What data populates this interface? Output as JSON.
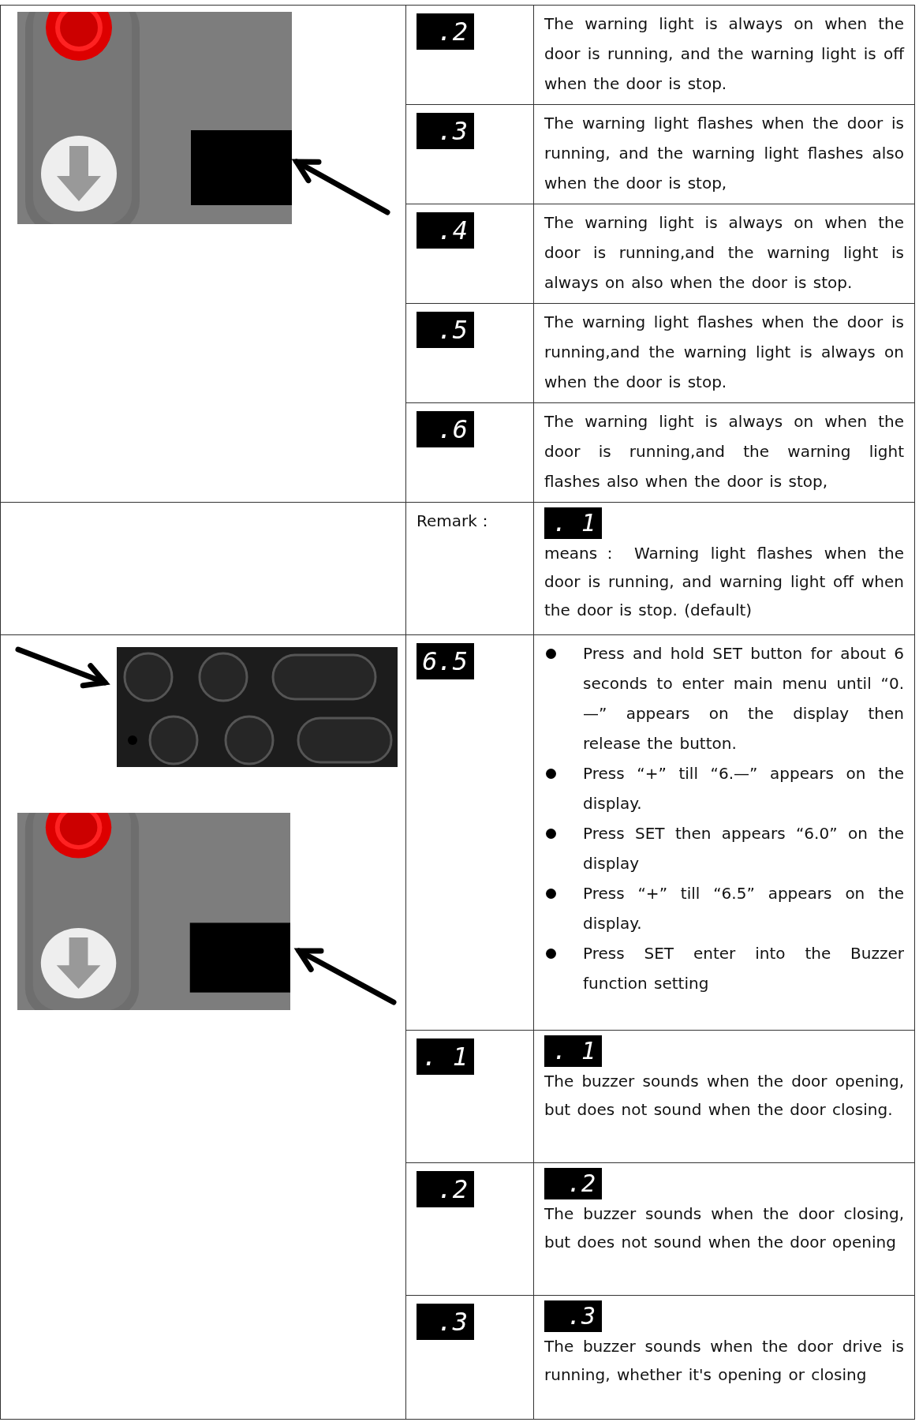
{
  "warning_light_section": {
    "rows": [
      {
        "display": ".2",
        "description": "The warning light is always on when the door is running, and the warning light is off when the door is stop."
      },
      {
        "display": ".3",
        "description": "The warning light flashes when the door is running, and the warning light flashes also when the door is stop,"
      },
      {
        "display": ".4",
        "description": "The warning light is always on when the door is running,and the warning light is always on also when the door is stop."
      },
      {
        "display": ".5",
        "description": "The warning light flashes when the door is running,and the warning light is always on when the door is stop."
      },
      {
        "display": ".6",
        "description": "The warning light is always on when the door is running,and the warning light flashes also when the door is stop,"
      }
    ]
  },
  "remark": {
    "label": "Remark：",
    "display": ". 1",
    "description": "means： Warning light flashes when the door is running, and warning light off when the door is stop. (default)"
  },
  "buzzer_section": {
    "display": "6.5",
    "steps": [
      "Press and hold SET button for about 6 seconds to enter main menu until “0.—” appears on the display then release the button.",
      "Press “+” till “6.—” appears on the display.",
      "Press SET then appears “6.0” on the display",
      "Press “+” till “6.5” appears on the display.",
      "Press  SET enter into the Buzzer function setting"
    ],
    "rows": [
      {
        "display": ". 1",
        "inline_display": ". 1",
        "description": "The buzzer sounds when the door opening, but does not sound when the door closing."
      },
      {
        "display": ".2",
        "inline_display": ".2",
        "description": "The buzzer sounds when the door closing, but does not sound when the door opening"
      },
      {
        "display": ".3",
        "inline_display": ".3",
        "description": "The buzzer sounds when the door drive is running, whether it's opening or closing"
      }
    ]
  }
}
